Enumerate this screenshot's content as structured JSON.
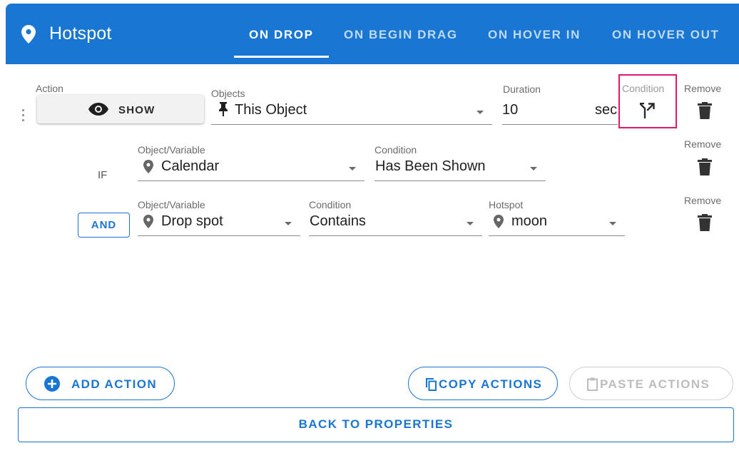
{
  "header": {
    "title": "Hotspot",
    "tabs": [
      {
        "label": "ON DROP",
        "active": true
      },
      {
        "label": "ON BEGIN DRAG",
        "active": false
      },
      {
        "label": "ON HOVER IN",
        "active": false
      },
      {
        "label": "ON HOVER OUT",
        "active": false
      }
    ]
  },
  "action_row": {
    "action_label": "Action",
    "action_button": "SHOW",
    "objects_label": "Objects",
    "objects_value": "This Object",
    "duration_label": "Duration",
    "duration_value": "10",
    "duration_unit": "sec",
    "condition_label": "Condition",
    "remove_label": "Remove"
  },
  "if_row": {
    "prefix": "IF",
    "object_label": "Object/Variable",
    "object_value": "Calendar",
    "condition_label": "Condition",
    "condition_value": "Has Been Shown",
    "remove_label": "Remove"
  },
  "and_row": {
    "prefix": "AND",
    "object_label": "Object/Variable",
    "object_value": "Drop spot",
    "condition_label": "Condition",
    "condition_value": "Contains",
    "hotspot_label": "Hotspot",
    "hotspot_value": "moon",
    "remove_label": "Remove"
  },
  "footer": {
    "add_action": "ADD ACTION",
    "copy_actions": "COPY ACTIONS",
    "paste_actions": "PASTE ACTIONS",
    "back": "BACK TO PROPERTIES"
  },
  "colors": {
    "primary": "#1976d2",
    "highlight": "#e0176f",
    "disabled": "#bdbdbd"
  }
}
